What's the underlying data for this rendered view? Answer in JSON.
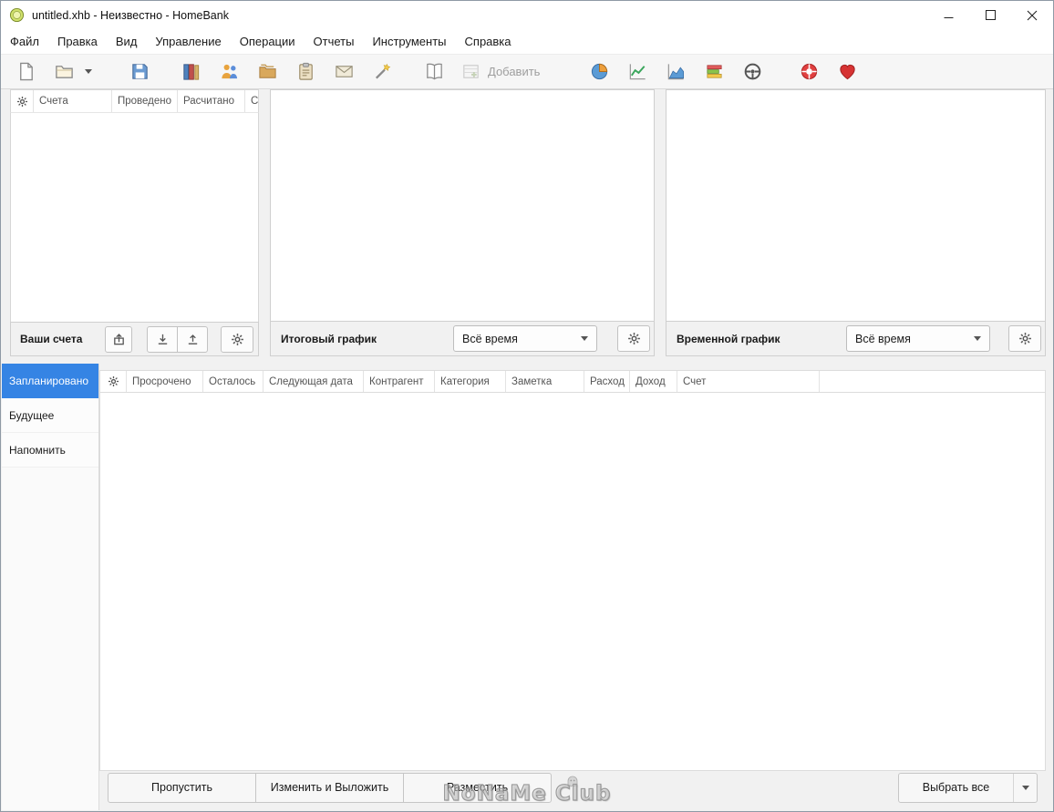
{
  "titlebar": {
    "title": "untitled.xhb - Неизвестно - HomeBank"
  },
  "menubar": {
    "items": [
      "Файл",
      "Правка",
      "Вид",
      "Управление",
      "Операции",
      "Отчеты",
      "Инструменты",
      "Справка"
    ]
  },
  "toolbar": {
    "add_label": "Добавить",
    "icon_names": [
      "new-file",
      "open",
      "open-dropdown",
      "save",
      "accounts-ledger",
      "payees",
      "categories",
      "scheduled-clipboard",
      "budget-envelope",
      "assign-wand",
      "show-operations-book",
      "add-operation",
      "statistics-pie",
      "trend-time-chart",
      "balance-chart",
      "budget-report-bars",
      "vehicle-cost-wheel",
      "help-lifebuoy",
      "donate-heart"
    ]
  },
  "accounts_panel": {
    "columns": [
      "Счета",
      "Проведено",
      "Расчитано",
      "Се"
    ],
    "footer_label": "Ваши счета"
  },
  "total_chart_panel": {
    "title": "Итоговый график",
    "range_value": "Всё время"
  },
  "time_chart_panel": {
    "title": "Временной график",
    "range_value": "Всё время"
  },
  "scheduled_panel": {
    "tabs": [
      "Запланировано",
      "Будущее",
      "Напомнить"
    ],
    "selected_tab": "Запланировано",
    "columns": [
      "Просрочено",
      "Осталось",
      "Следующая дата",
      "Контрагент",
      "Категория",
      "Заметка",
      "Расход",
      "Доход",
      "Счет"
    ],
    "actions": {
      "skip": "Пропустить",
      "edit_post": "Изменить и Выложить",
      "post": "Разместить",
      "select_all": "Выбрать все"
    }
  },
  "watermark": "NoNaMe Club"
}
